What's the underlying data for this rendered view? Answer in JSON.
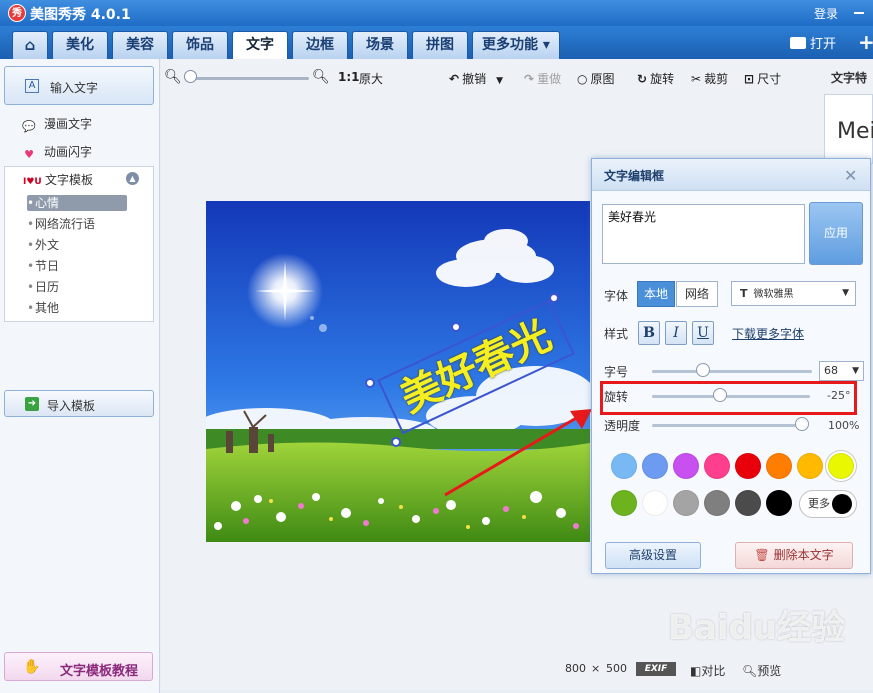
{
  "app": {
    "title": "美图秀秀 4.0.1",
    "logo_text": "秀",
    "login": "登录"
  },
  "tabs": [
    {
      "label": "⌂"
    },
    {
      "label": "美化"
    },
    {
      "label": "美容"
    },
    {
      "label": "饰品"
    },
    {
      "label": "文字"
    },
    {
      "label": "边框"
    },
    {
      "label": "场景"
    },
    {
      "label": "拼图"
    },
    {
      "label": "更多功能 ▾"
    }
  ],
  "header_actions": {
    "open": "打开",
    "plus": "+"
  },
  "left_panel": {
    "input_text": "输入文字",
    "comic_text": "漫画文字",
    "flash_text": "动画闪字",
    "templates_title": "文字模板",
    "template_items": [
      "心情",
      "网络流行语",
      "外文",
      "节日",
      "日历",
      "其他"
    ],
    "import_template": "导入模板",
    "tutorial": "文字模板教程"
  },
  "toolbar": {
    "ratio": "1:1",
    "original_size": "原大",
    "undo": "撤销",
    "redo": "重做",
    "original": "原图",
    "rotate": "旋转",
    "crop": "裁剪",
    "size": "尺寸"
  },
  "right_panel": {
    "label": "文字特",
    "thumb_text": "Mei"
  },
  "overlay": {
    "text": "美好春光"
  },
  "status": {
    "width": "800",
    "times": "×",
    "height": "500",
    "exif": "EXIF",
    "compare": "对比",
    "preview": "预览"
  },
  "dialog": {
    "title": "文字编辑框",
    "text_value": "美好春光",
    "apply": "应用",
    "font_label": "字体",
    "font_local": "本地",
    "font_web": "网络",
    "font_name": "微软雅黑",
    "style_label": "样式",
    "bold": "B",
    "italic": "I",
    "underline": "U",
    "more_fonts": "下载更多字体",
    "size_label": "字号",
    "size_value": "68",
    "rotate_label": "旋转",
    "rotate_value": "-25°",
    "opacity_label": "透明度",
    "opacity_value": "100%",
    "more_colors": "更多",
    "advanced": "高级设置",
    "delete": "删除本文字"
  },
  "colors": {
    "row1": [
      "#78b9f5",
      "#6d9bf2",
      "#c84ff0",
      "#ff3e8e",
      "#e8000b",
      "#ff7d00",
      "#ffba00",
      "#e9f800"
    ],
    "row2": [
      "#6db31f",
      "#ffffff",
      "#a4a4a4",
      "#7f7f7f",
      "#4b4b4b",
      "#000000"
    ],
    "selected": "#e9f800"
  },
  "watermark": "Baidu经验"
}
